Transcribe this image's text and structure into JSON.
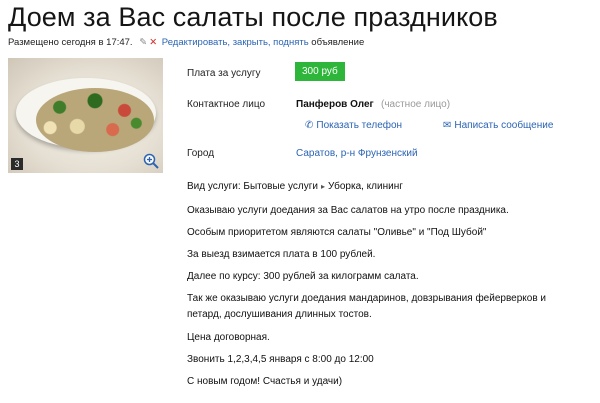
{
  "header": {
    "title": "Доем за Вас салаты после праздников",
    "posted": "Размещено сегодня в 17:47.",
    "actions_link": "Редактировать, закрыть, поднять",
    "actions_suffix": "объявление"
  },
  "photo": {
    "count": "3",
    "zoom_icon": "magnifier-plus-icon"
  },
  "fields": {
    "price_label": "Плата за услугу",
    "price_value": "300 руб",
    "contact_label": "Контактное лицо",
    "contact_name": "Панферов Олег",
    "contact_type": "(частное лицо)",
    "show_phone": "Показать телефон",
    "write_message": "Написать сообщение",
    "city_label": "Город",
    "city_value": "Саратов, р-н Фрунзенский"
  },
  "service": {
    "prefix": "Вид услуги:",
    "category": "Бытовые услуги",
    "subcategory": "Уборка, клининг"
  },
  "description": [
    "Оказываю услуги доедания за Вас салатов на утро после праздника.",
    "Особым приоритетом являются салаты \"Оливье\" и \"Под Шубой\"",
    "За выезд взимается плата в 100 рублей.",
    "Далее по курсу: 300 рублей за килограмм салата.",
    "Так же оказываю услуги доедания мандаринов, довзрывания фейерверков и",
    "петард, дослушивания длинных тостов.",
    "Цена договорная.",
    "Звонить 1,2,3,4,5 января с 8:00 до 12:00",
    "С новым годом! Счастья и удачи)"
  ],
  "colors": {
    "price_badge": "#2eb63b",
    "link": "#2b64b3",
    "muted": "#9a9a9a"
  }
}
